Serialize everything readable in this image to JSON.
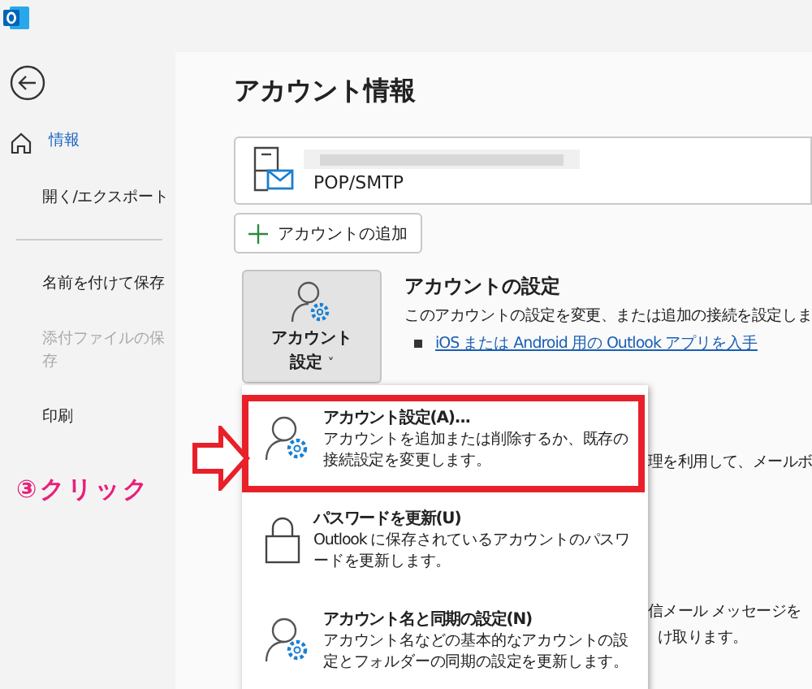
{
  "sidebar": {
    "items": [
      {
        "label": "情報",
        "kind": "home",
        "selected": true,
        "disabled": false
      },
      {
        "label": "開く/エクスポート",
        "kind": "plain",
        "selected": false,
        "disabled": false
      },
      {
        "kind": "divider"
      },
      {
        "label": "名前を付けて保存",
        "kind": "plain",
        "selected": false,
        "disabled": false
      },
      {
        "label": "添付ファイルの保存",
        "kind": "plain",
        "selected": false,
        "disabled": true
      },
      {
        "label": "印刷",
        "kind": "plain",
        "selected": false,
        "disabled": false
      }
    ]
  },
  "main": {
    "title": "アカウント情報",
    "account": {
      "type": "POP/SMTP"
    },
    "add_button": "アカウントの追加",
    "settings_button": {
      "line_1": "アカウント",
      "line_2": "設定",
      "caret": "˅"
    },
    "settings": {
      "heading": "アカウントの設定",
      "description": "このアカウントの設定を変更、または追加の接続を設定しま",
      "link": "iOS または Android 用の Outlook アプリを入手"
    },
    "behind_texts": [
      "理を利用して、メールボ",
      "信メール メッセージを",
      "け取ります。"
    ]
  },
  "menu": {
    "items": [
      {
        "kind": "person",
        "title": "アカウント設定(A)...",
        "description": "アカウントを追加または削除するか、既存の接続設定を変更します。",
        "selected": true
      },
      {
        "kind": "lock",
        "title": "パスワードを更新(U)",
        "description": "Outlook に保存されているアカウントのパスワードを更新します。",
        "selected": false
      },
      {
        "kind": "person",
        "title": "アカウント名と同期の設定(N)",
        "description": "アカウント名などの基本的なアカウントの設定とフォルダーの同期の設定を更新します。",
        "selected": false
      }
    ]
  },
  "annotation": {
    "label": "③クリック"
  }
}
